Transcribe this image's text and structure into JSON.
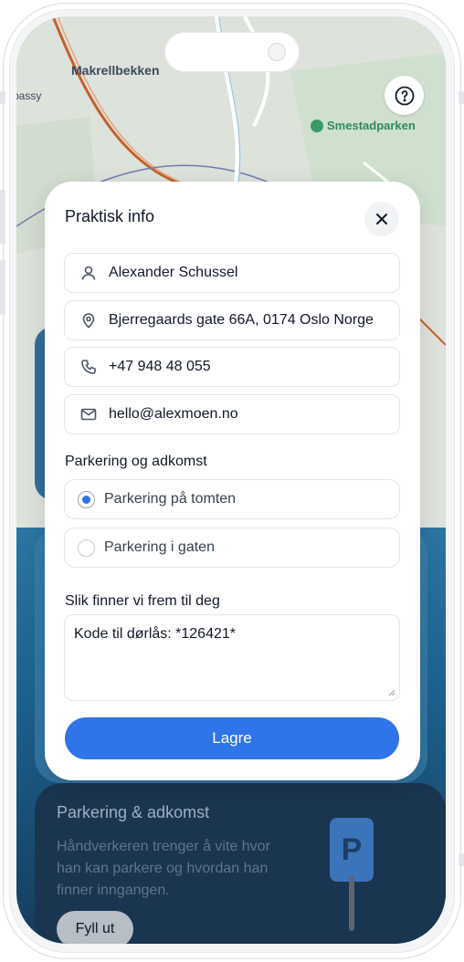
{
  "map": {
    "labels": [
      "Makrellbekken",
      "passy"
    ],
    "park_label": "Smestadparken",
    "help_icon": "question-circle-icon"
  },
  "modal": {
    "title": "Praktisk info",
    "close_icon": "close-icon",
    "fields": [
      {
        "icon": "user-icon",
        "value": "Alexander Schussel"
      },
      {
        "icon": "location-pin-icon",
        "value": "Bjerregaards gate 66A, 0174 Oslo Norge"
      },
      {
        "icon": "phone-icon",
        "value": "+47 948 48 055"
      },
      {
        "icon": "mail-icon",
        "value": "hello@alexmoen.no"
      }
    ],
    "parking_section_label": "Parkering og adkomst",
    "parking_options": [
      {
        "label": "Parkering på tomten",
        "selected": true
      },
      {
        "label": "Parkering i gaten",
        "selected": false
      }
    ],
    "directions_label": "Slik finner vi frem til deg",
    "directions_value": "Kode til dørlås: *126421*",
    "save_label": "Lagre"
  },
  "parking_card": {
    "title": "Parkering & adkomst",
    "description": "Håndverkeren trenger å vite hvor han kan parkere og hvordan han finner inngangen.",
    "button_label": "Fyll ut",
    "sign_letter": "P"
  },
  "colors": {
    "accent": "#2f74e8",
    "card_dark": "#1a3550",
    "park_green": "#3a9a64"
  }
}
